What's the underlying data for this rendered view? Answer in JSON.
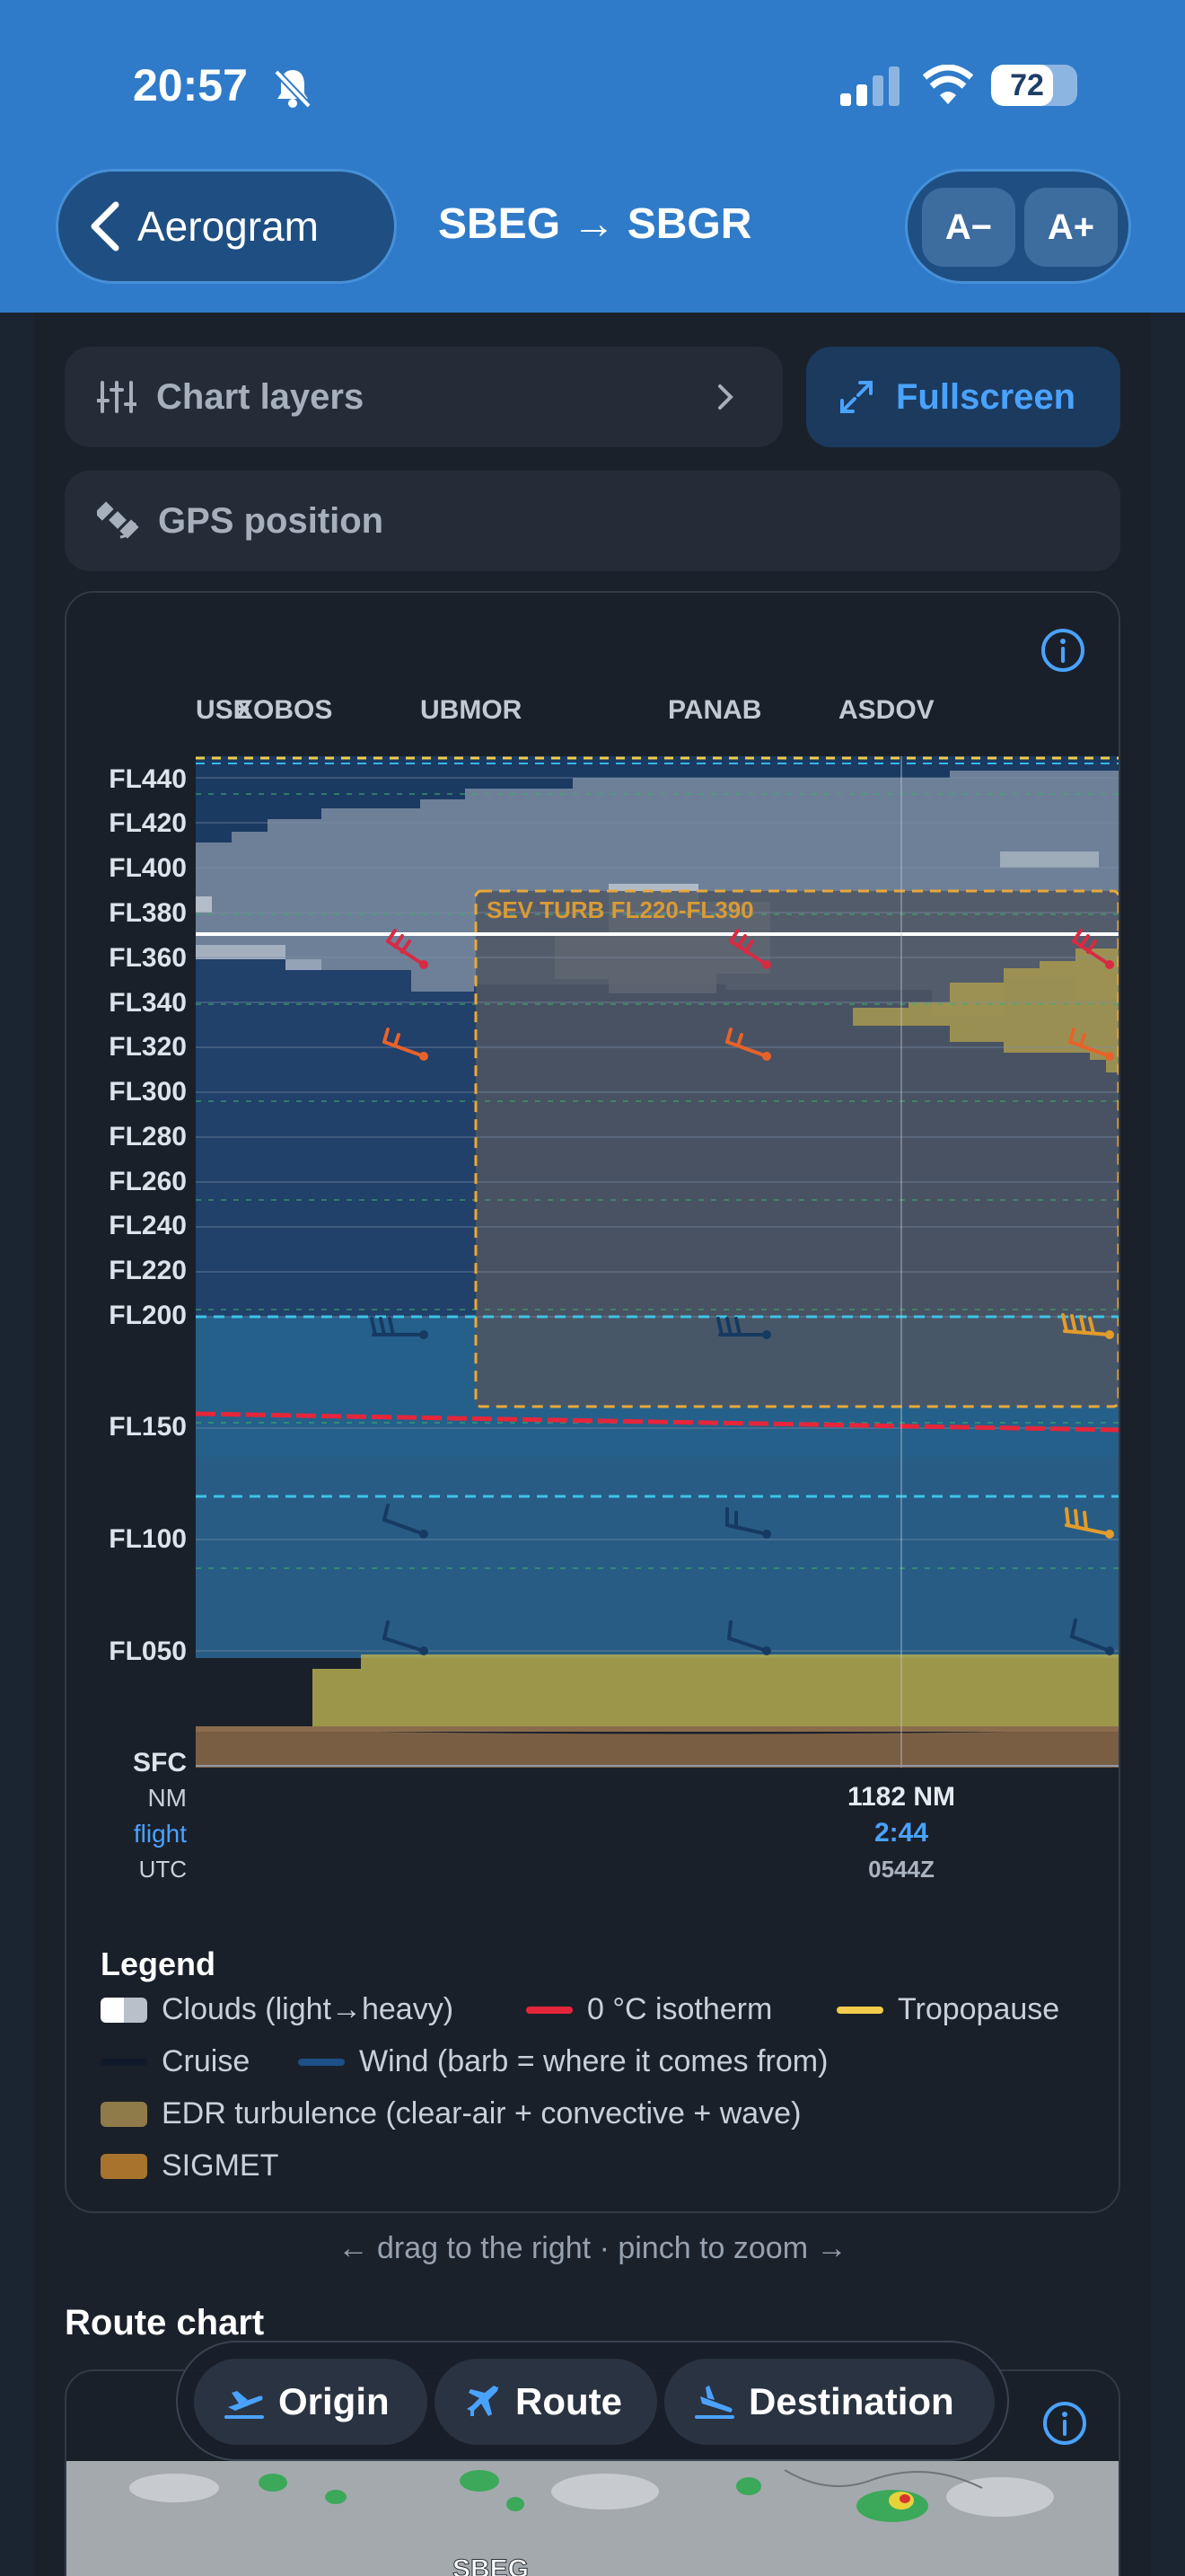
{
  "status_bar": {
    "time": "20:57",
    "battery": "72",
    "battery_level": 0.72
  },
  "header": {
    "back_label": "Aerogram",
    "title": "SBEG → SBGR",
    "font_smaller": "A−",
    "font_larger": "A+"
  },
  "controls": {
    "chart_layers": "Chart layers",
    "fullscreen": "Fullscreen",
    "gps_position": "GPS position"
  },
  "chart": {
    "waypoints": [
      "USE",
      "XOBOS",
      "UBMOR",
      "PANAB",
      "ASDOV"
    ],
    "levels": [
      "FL440",
      "FL420",
      "FL400",
      "FL380",
      "FL360",
      "FL340",
      "FL320",
      "FL300",
      "FL280",
      "FL260",
      "FL240",
      "FL220",
      "FL200",
      "FL150",
      "FL100",
      "FL050",
      "SFC"
    ],
    "sev_turb_label": "SEV TURB FL220-FL390",
    "axis": {
      "nm_label": "NM",
      "flight_label": "flight",
      "utc_label": "UTC",
      "nm_value": "1182 NM",
      "flight_value": "2:44",
      "utc_value": "0544Z"
    }
  },
  "legend": {
    "title": "Legend",
    "items": [
      "Clouds (light→heavy)",
      "0 °C isotherm",
      "Tropopause",
      "Cruise",
      "Wind (barb = where it comes from)",
      "EDR turbulence (clear-air + convective + wave)",
      "SIGMET"
    ]
  },
  "hint": "← drag to the right · pinch to zoom →",
  "route_chart": {
    "title": "Route chart",
    "map_label": "SBEG"
  },
  "nav": {
    "origin": "Origin",
    "route": "Route",
    "destination": "Destination"
  },
  "colors": {
    "header": "#2f7bc9",
    "accent": "#4aa2ff",
    "isotherm": "#e5263a",
    "tropopause": "#f0cc4a",
    "turbulence": "#b9a25a",
    "sigmet": "#a8732c",
    "wind": "#1e4f86"
  }
}
